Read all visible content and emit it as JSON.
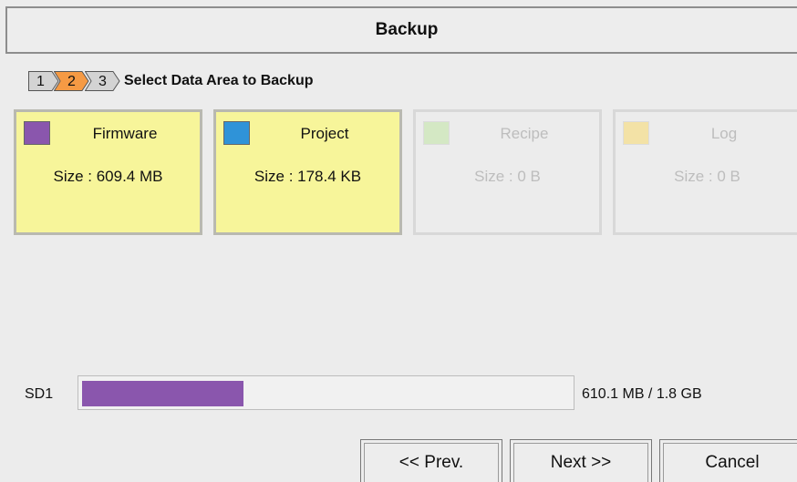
{
  "title": "Backup",
  "wizard": {
    "steps": [
      "1",
      "2",
      "3"
    ],
    "current_step": 2,
    "step_colors": {
      "inactive": "#d3d3d3",
      "active": "#f59a44"
    },
    "heading": "Select Data Area to Backup"
  },
  "areas": [
    {
      "name": "Firmware",
      "size": "Size : 609.4 MB",
      "color": "#8a56ad",
      "selected": true,
      "enabled": true
    },
    {
      "name": "Project",
      "size": "Size : 178.4 KB",
      "color": "#2f93d8",
      "selected": true,
      "enabled": true
    },
    {
      "name": "Recipe",
      "size": "Size : 0 B",
      "color": "#d4e8c4",
      "selected": false,
      "enabled": false
    },
    {
      "name": "Log",
      "size": "Size : 0 B",
      "color": "#f3e2a6",
      "selected": false,
      "enabled": false
    }
  ],
  "storage": {
    "label": "SD1",
    "usage_text": "610.1 MB / 1.8 GB",
    "used_fraction": 0.33,
    "fill_color": "#8a56ad"
  },
  "buttons": {
    "prev": "<< Prev.",
    "next": "Next >>",
    "cancel": "Cancel"
  }
}
